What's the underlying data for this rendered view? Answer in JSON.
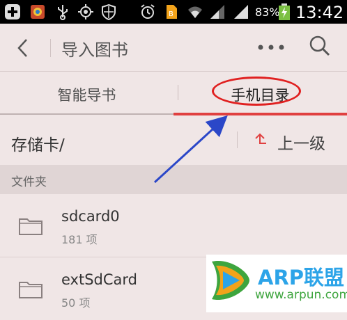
{
  "status_bar": {
    "battery_percent": "83%",
    "time": "13:42",
    "icons": [
      "notification-plus-icon",
      "photo-app-icon",
      "usb-icon",
      "gps-icon",
      "shield-icon",
      "alarm-icon",
      "document-icon",
      "wifi-icon",
      "signal-icon",
      "battery-icon"
    ]
  },
  "header": {
    "title": "导入图书"
  },
  "tabs": [
    {
      "label": "智能导书",
      "active": false
    },
    {
      "label": "手机目录",
      "active": true
    }
  ],
  "path_bar": {
    "current_path": "存储卡/",
    "up_label": "上一级"
  },
  "section": {
    "label": "文件夹"
  },
  "items": [
    {
      "name": "sdcard0",
      "count": "181 项"
    },
    {
      "name": "extSdCard",
      "count": "50 项"
    }
  ],
  "watermark": {
    "brand": "ARP联盟",
    "url": "www.arpun.com"
  },
  "colors": {
    "background": "#f0e6e6",
    "accent": "#e04040",
    "annotation_circle": "#e02020",
    "annotation_arrow": "#2b47c8"
  }
}
